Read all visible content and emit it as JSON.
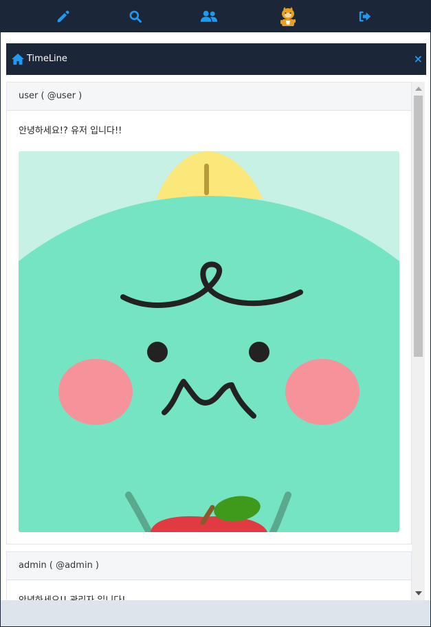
{
  "nav": {
    "items": [
      {
        "name": "write",
        "icon": "pencil-icon"
      },
      {
        "name": "search",
        "icon": "search-icon"
      },
      {
        "name": "users",
        "icon": "users-icon"
      },
      {
        "name": "profile",
        "icon": "avatar-icon"
      },
      {
        "name": "logout",
        "icon": "sign-out-icon"
      }
    ],
    "icon_color": "#1e9af0",
    "bar_color": "#1b2638"
  },
  "panel": {
    "title": "TimeLine",
    "close_label": "×",
    "home_icon": "home-icon"
  },
  "posts": [
    {
      "author": "user ( @user )",
      "text": "안녕하세요!? 유저 입니다!!",
      "image": "character-illustration"
    },
    {
      "author": "admin ( @admin )",
      "text": "안녕하세요!! 관리자 입니다!"
    }
  ]
}
